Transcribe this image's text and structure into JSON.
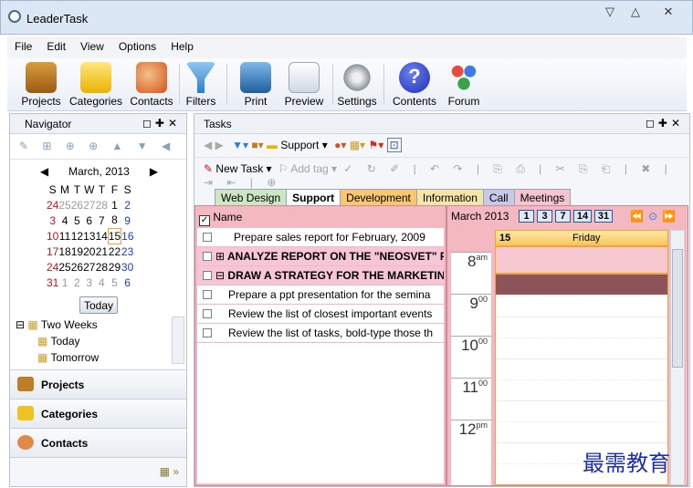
{
  "app": {
    "title": "LeaderTask"
  },
  "menu": [
    "File",
    "Edit",
    "View",
    "Options",
    "Help"
  ],
  "toolbar": {
    "items": [
      {
        "label": "Projects",
        "icon": "briefcase-icon"
      },
      {
        "label": "Categories",
        "icon": "categories-icon"
      },
      {
        "label": "Contacts",
        "icon": "contacts-icon"
      },
      {
        "label": "Filters",
        "icon": "funnel-icon"
      },
      {
        "label": "Print",
        "icon": "printer-icon"
      },
      {
        "label": "Preview",
        "icon": "preview-icon"
      },
      {
        "label": "Settings",
        "icon": "gears-icon"
      },
      {
        "label": "Contents",
        "icon": "help-icon"
      },
      {
        "label": "Forum",
        "icon": "forum-icon"
      }
    ]
  },
  "navigator": {
    "title": "Navigator",
    "month": "March, 2013",
    "weekdays": [
      "S",
      "M",
      "T",
      "W",
      "T",
      "F",
      "S"
    ],
    "weeks": [
      [
        "24",
        "25",
        "26",
        "27",
        "28",
        "1",
        "2"
      ],
      [
        "3",
        "4",
        "5",
        "6",
        "7",
        "8",
        "9"
      ],
      [
        "10",
        "11",
        "12",
        "13",
        "14",
        "15",
        "16"
      ],
      [
        "17",
        "18",
        "19",
        "20",
        "21",
        "22",
        "23"
      ],
      [
        "24",
        "25",
        "26",
        "27",
        "28",
        "29",
        "30"
      ],
      [
        "31",
        "1",
        "2",
        "3",
        "4",
        "5",
        "6"
      ]
    ],
    "today_button": "Today",
    "tree": [
      "Two Weeks",
      "Today",
      "Tomorrow"
    ],
    "sections": [
      "Projects",
      "Categories",
      "Contacts"
    ]
  },
  "tasks": {
    "title": "Tasks",
    "support_filter": "Support",
    "new_task": "New Task",
    "add_tag": "Add tag",
    "tabs": [
      "Web Design",
      "Support",
      "Development",
      "Information",
      "Call",
      "Meetings"
    ],
    "active_tab": "Support",
    "column_header": "Name",
    "rows": [
      {
        "text": "Prepare sales report for February, 2009",
        "style": "normal"
      },
      {
        "text": "ANALYZE REPORT ON THE \"NEOSVET\" PR",
        "style": "group"
      },
      {
        "text": "DRAW A STRATEGY FOR THE MARKETING",
        "style": "group"
      },
      {
        "text": "Prepare a ppt presentation for the semina",
        "style": "child"
      },
      {
        "text": "Review the list of closest important events",
        "style": "child"
      },
      {
        "text": "Review the list of tasks, bold-type those th",
        "style": "child"
      }
    ]
  },
  "dayview": {
    "month": "March 2013",
    "view_buttons": [
      "1",
      "3",
      "7",
      "14",
      "31"
    ],
    "date": "15",
    "weekday": "Friday",
    "hours": [
      {
        "h": "8",
        "s": "am"
      },
      {
        "h": "9",
        "s": "00"
      },
      {
        "h": "10",
        "s": "00"
      },
      {
        "h": "11",
        "s": "00"
      },
      {
        "h": "12",
        "s": "pm"
      }
    ]
  },
  "watermark": "最需教育",
  "colors": {
    "accent": "#f0a436",
    "pink": "#f4b9c0",
    "group_row": "#f7c6d6",
    "event": "#8c5358"
  }
}
